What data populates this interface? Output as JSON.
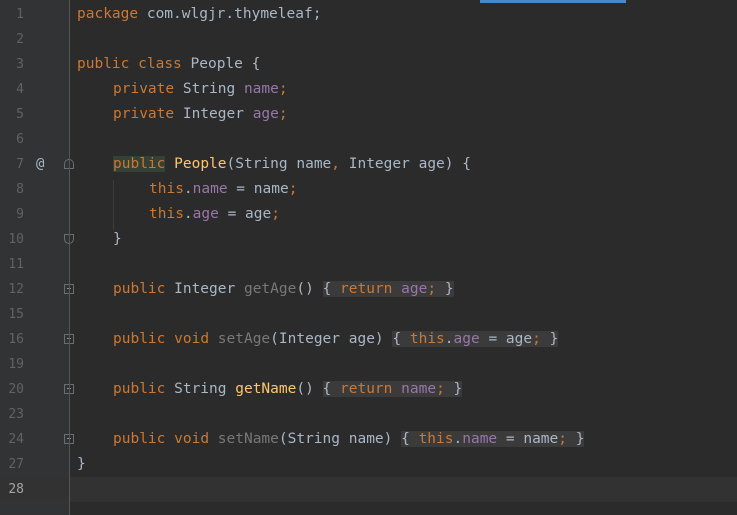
{
  "editor": {
    "gutter": {
      "line_numbers": [
        "1",
        "2",
        "3",
        "4",
        "5",
        "6",
        "7",
        "8",
        "9",
        "10",
        "11",
        "12",
        "15",
        "16",
        "19",
        "20",
        "23",
        "24",
        "27",
        "28"
      ],
      "override_marker": "@"
    },
    "lines": {
      "l1": {
        "a": "package",
        "b": " com.wlgjr.thymeleaf;"
      },
      "l3": {
        "a": "public",
        "b": " ",
        "c": "class",
        "d": " People {"
      },
      "l4": {
        "a": "private",
        "b": " String ",
        "c": "name",
        "d": ";"
      },
      "l5": {
        "a": "private",
        "b": " Integer ",
        "c": "age",
        "d": ";"
      },
      "l7": {
        "a": "public",
        "b": " ",
        "c": "People",
        "d": "(String name",
        "e": ",",
        "f": " Integer age) {"
      },
      "l8": {
        "a": "this",
        "b": ".",
        "c": "name",
        "d": " = name",
        "e": ";"
      },
      "l9": {
        "a": "this",
        "b": ".",
        "c": "age",
        "d": " = age",
        "e": ";"
      },
      "l10": {
        "a": "}"
      },
      "l12": {
        "a": "public",
        "b": " Integer ",
        "c": "getAge",
        "d": "() ",
        "e": "{ ",
        "f": "return",
        "g": " ",
        "h": "age",
        "i": ";",
        "j": " }"
      },
      "l16": {
        "a": "public",
        "b": " ",
        "c": "void",
        "d": " ",
        "e": "setAge",
        "f": "(Integer age) ",
        "g": "{ ",
        "h": "this",
        "i": ".",
        "j": "age",
        "k": " = age",
        "l": ";",
        "m": " }"
      },
      "l20": {
        "a": "public",
        "b": " String ",
        "c": "getName",
        "d": "() ",
        "e": "{ ",
        "f": "return",
        "g": " ",
        "h": "name",
        "i": ";",
        "j": " }"
      },
      "l24": {
        "a": "public",
        "b": " ",
        "c": "void",
        "d": " ",
        "e": "setName",
        "f": "(String name) ",
        "g": "{ ",
        "h": "this",
        "i": ".",
        "j": "name",
        "k": " = name",
        "l": ";",
        "m": " }"
      },
      "l27": {
        "a": "}"
      }
    },
    "colors": {
      "background": "#2b2b2b",
      "gutter": "#313335",
      "keyword": "#cc7832",
      "field": "#9876aa",
      "method": "#ffc66d",
      "text": "#a9b7c6",
      "line_number": "#606366",
      "current_line": "#323232"
    },
    "icons": [
      "override-marker-icon",
      "fold-icon"
    ]
  }
}
